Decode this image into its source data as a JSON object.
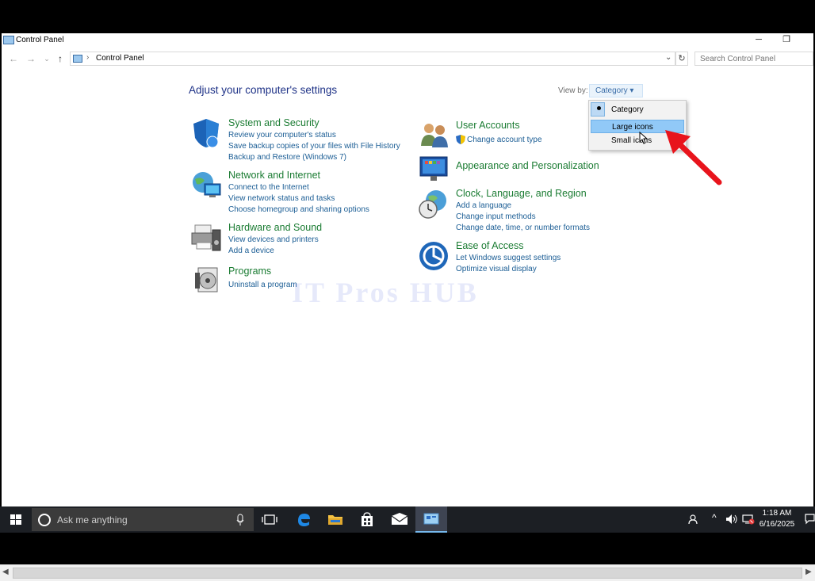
{
  "window": {
    "title": "Control Panel",
    "minimize": "─",
    "restore": "❐"
  },
  "nav": {
    "back": "←",
    "forward": "→",
    "recent": "⌄",
    "up": "↑",
    "address_sep": "›",
    "address": "Control Panel",
    "address_dropdown": "⌄",
    "refresh": "↻",
    "search_placeholder": "Search Control Panel"
  },
  "main": {
    "heading": "Adjust your computer's settings",
    "view_by_label": "View by:",
    "view_by_value": "Category ▾"
  },
  "categories_left": [
    {
      "title": "System and Security",
      "links": [
        "Review your computer's status",
        "Save backup copies of your files with File History",
        "Backup and Restore (Windows 7)"
      ]
    },
    {
      "title": "Network and Internet",
      "links": [
        "Connect to the Internet",
        "View network status and tasks",
        "Choose homegroup and sharing options"
      ]
    },
    {
      "title": "Hardware and Sound",
      "links": [
        "View devices and printers",
        "Add a device"
      ]
    },
    {
      "title": "Programs",
      "links": [
        "Uninstall a program"
      ]
    }
  ],
  "categories_right": [
    {
      "title": "User Accounts",
      "links": [
        "Change account type"
      ]
    },
    {
      "title": "Appearance and Personalization",
      "links": []
    },
    {
      "title": "Clock, Language, and Region",
      "links": [
        "Add a language",
        "Change input methods",
        "Change date, time, or number formats"
      ]
    },
    {
      "title": "Ease of Access",
      "links": [
        "Let Windows suggest settings",
        "Optimize visual display"
      ]
    }
  ],
  "dropdown": {
    "items": [
      "Category",
      "Large icons",
      "Small icons"
    ],
    "selected": "Category",
    "hovered": "Large icons"
  },
  "watermark": "IT Pros HUB",
  "taskbar": {
    "search_text": "Ask me anything",
    "time": "1:18 AM",
    "date": "6/16/2025"
  },
  "colors": {
    "category_title": "#1b7c33",
    "link": "#1c5e95",
    "heading": "#1e3287",
    "arrow": "#e8141c",
    "taskbar": "#1c1f24"
  }
}
